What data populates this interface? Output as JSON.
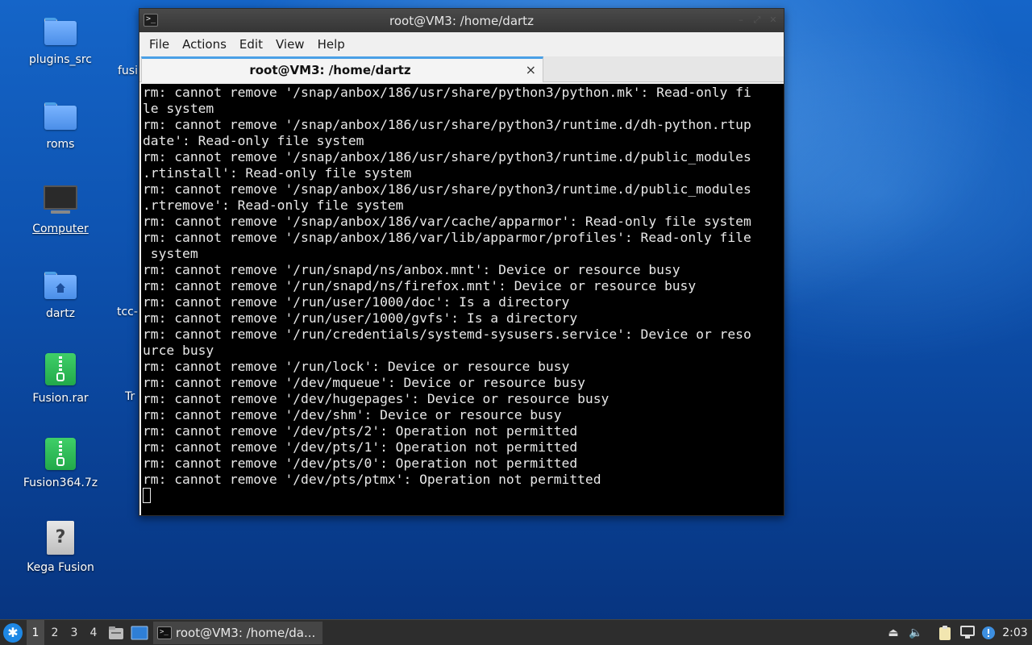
{
  "desktop": {
    "icons": [
      {
        "label": "plugins_src",
        "icon": "folder-icon"
      },
      {
        "label": "roms",
        "icon": "folder-icon"
      },
      {
        "label": "Computer",
        "icon": "computer-icon"
      },
      {
        "label": "dartz",
        "icon": "home-folder-icon"
      },
      {
        "label": "Fusion.rar",
        "icon": "archive-icon"
      },
      {
        "label": "Fusion364.7z",
        "icon": "archive-icon"
      },
      {
        "label": "Kega Fusion",
        "icon": "unknown-file-icon"
      }
    ],
    "partial_labels": [
      "fusi",
      "tcc-",
      "Tr"
    ]
  },
  "window": {
    "title": "root@VM3: /home/dartz",
    "menu": [
      "File",
      "Actions",
      "Edit",
      "View",
      "Help"
    ],
    "tab_label": "root@VM3: /home/dartz",
    "tab_close": "×",
    "terminal_lines": [
      "rm: cannot remove '/snap/anbox/186/usr/share/python3/python.mk': Read-only fi",
      "le system",
      "rm: cannot remove '/snap/anbox/186/usr/share/python3/runtime.d/dh-python.rtup",
      "date': Read-only file system",
      "rm: cannot remove '/snap/anbox/186/usr/share/python3/runtime.d/public_modules",
      ".rtinstall': Read-only file system",
      "rm: cannot remove '/snap/anbox/186/usr/share/python3/runtime.d/public_modules",
      ".rtremove': Read-only file system",
      "rm: cannot remove '/snap/anbox/186/var/cache/apparmor': Read-only file system",
      "rm: cannot remove '/snap/anbox/186/var/lib/apparmor/profiles': Read-only file",
      " system",
      "rm: cannot remove '/run/snapd/ns/anbox.mnt': Device or resource busy",
      "rm: cannot remove '/run/snapd/ns/firefox.mnt': Device or resource busy",
      "rm: cannot remove '/run/user/1000/doc': Is a directory",
      "rm: cannot remove '/run/user/1000/gvfs': Is a directory",
      "rm: cannot remove '/run/credentials/systemd-sysusers.service': Device or reso",
      "urce busy",
      "rm: cannot remove '/run/lock': Device or resource busy",
      "rm: cannot remove '/dev/mqueue': Device or resource busy",
      "rm: cannot remove '/dev/hugepages': Device or resource busy",
      "rm: cannot remove '/dev/shm': Device or resource busy",
      "rm: cannot remove '/dev/pts/2': Operation not permitted",
      "rm: cannot remove '/dev/pts/1': Operation not permitted",
      "rm: cannot remove '/dev/pts/0': Operation not permitted",
      "rm: cannot remove '/dev/pts/ptmx': Operation not permitted"
    ]
  },
  "taskbar": {
    "workspaces": [
      "1",
      "2",
      "3",
      "4"
    ],
    "active_workspace": "1",
    "task_label": "root@VM3: /home/da...",
    "clock": "2:03"
  }
}
